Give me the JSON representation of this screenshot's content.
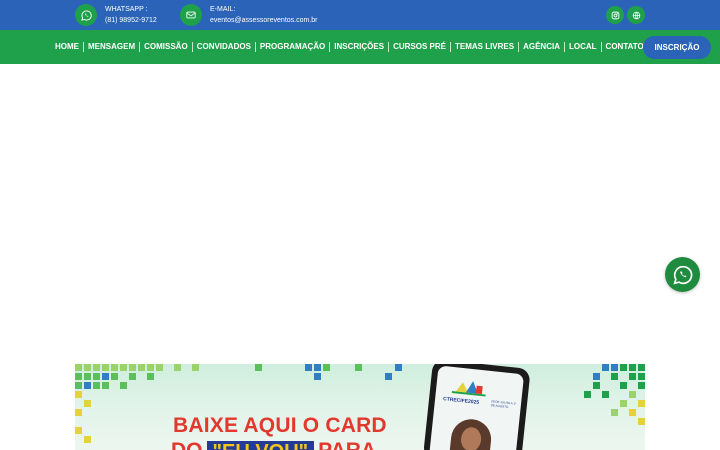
{
  "topbar": {
    "whatsapp_label": "WHATSAPP :",
    "whatsapp_value": "(81) 98952-9712",
    "email_label": "E-MAIL:",
    "email_value": "eventos@assessoreventos.com.br"
  },
  "nav": {
    "items": [
      "HOME",
      "MENSAGEM",
      "COMISSÃO",
      "CONVIDADOS",
      "PROGRAMAÇÃO",
      "INSCRIÇÕES",
      "CURSOS PRÉ",
      "TEMAS LIVRES",
      "AGÊNCIA",
      "LOCAL",
      "CONTATO"
    ],
    "cta_label": "INSCRIÇÃO"
  },
  "banner": {
    "headline": "BAIXE AQUI O CARD",
    "line2_start": "DO",
    "line2_box": "\"EU VOU\"",
    "line2_end": "PARA",
    "phone_logo": "CTRECIFE2025",
    "phone_tag": "28 DE JULHO A 1º DE AGOSTO"
  },
  "colors": {
    "blue": "#2a63b8",
    "green": "#1fa14b",
    "red": "#e2382e"
  },
  "icons": {
    "whatsapp": "whatsapp-icon",
    "email": "envelope-icon",
    "instagram": "instagram-icon",
    "website": "globe-icon",
    "floating": "whatsapp-icon"
  }
}
